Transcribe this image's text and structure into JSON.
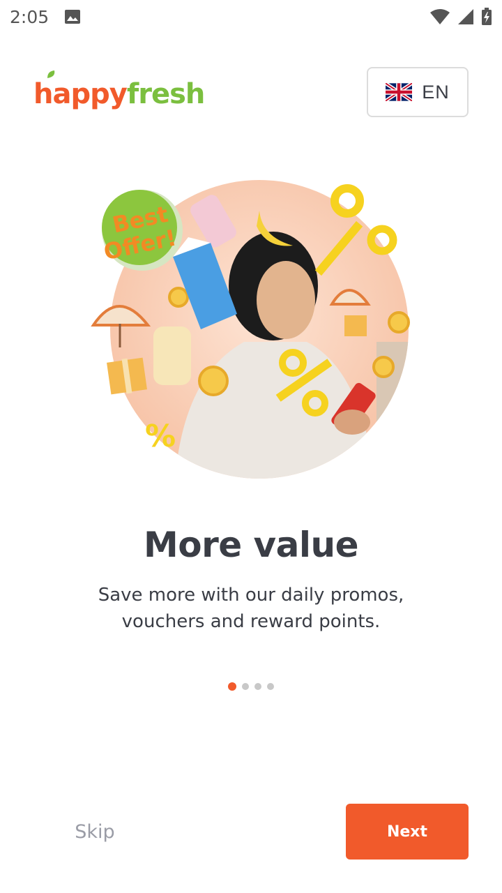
{
  "status_bar": {
    "time": "2:05",
    "icons": [
      "gallery-icon",
      "wifi-icon",
      "cell-signal-icon",
      "battery-icon"
    ]
  },
  "header": {
    "logo_happy": "happy",
    "logo_fresh": "fresh",
    "language": {
      "code": "EN",
      "flag": "uk-flag-icon"
    }
  },
  "onboarding": {
    "badge_text_1": "Best",
    "badge_text_2": "Offer!",
    "title": "More value",
    "subtitle": "Save more with our daily promos, vouchers and reward points.",
    "page_index": 1,
    "page_count": 4
  },
  "actions": {
    "skip_label": "Skip",
    "next_label": "Next"
  },
  "colors": {
    "brand_orange": "#f15a2b",
    "brand_green": "#7bbf3f",
    "text_dark": "#3a3d45",
    "text_muted": "#9a9ca6"
  }
}
